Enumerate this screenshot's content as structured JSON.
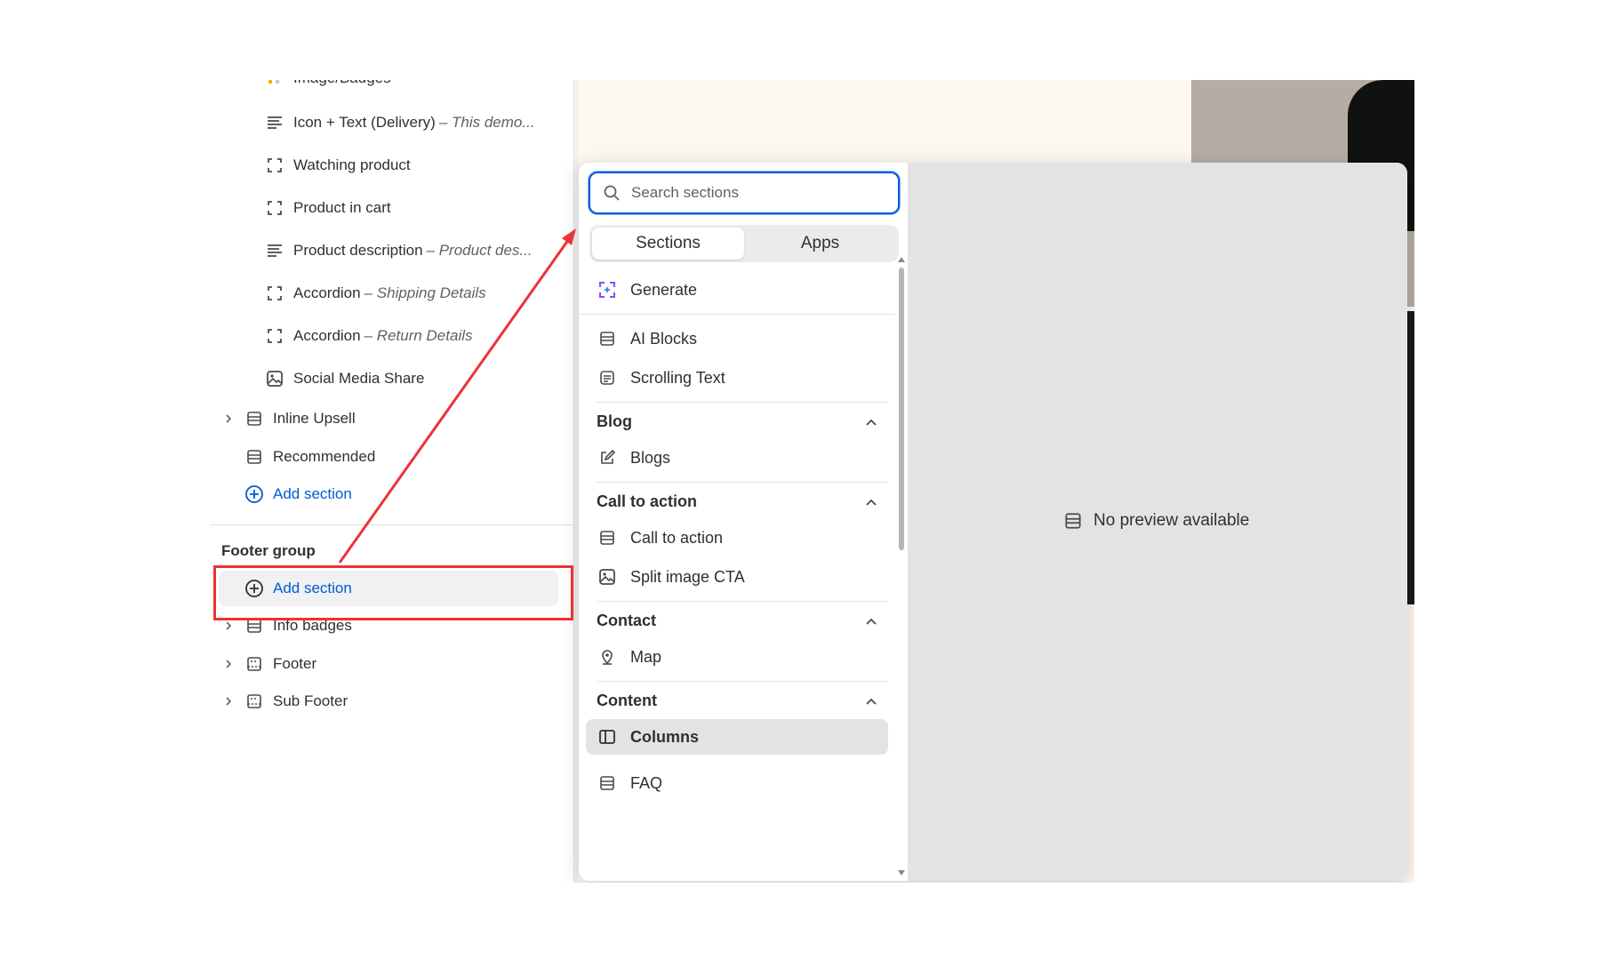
{
  "sidebar": {
    "top_partial_label": "Image/Badges",
    "blocks": [
      {
        "icon": "text-lines-icon",
        "label": "Icon + Text (Delivery)",
        "sub": "– This demo..."
      },
      {
        "icon": "block-frame-icon",
        "label": "Watching product",
        "sub": ""
      },
      {
        "icon": "block-frame-icon",
        "label": "Product in cart",
        "sub": ""
      },
      {
        "icon": "text-lines-icon",
        "label": "Product description",
        "sub": "– Product des..."
      },
      {
        "icon": "block-frame-icon",
        "label": "Accordion",
        "sub": "– Shipping Details"
      },
      {
        "icon": "block-frame-icon",
        "label": "Accordion",
        "sub": "– Return Details"
      },
      {
        "icon": "image-icon",
        "label": "Social Media Share",
        "sub": ""
      }
    ],
    "sections": [
      {
        "label": "Inline Upsell",
        "expandable": true
      },
      {
        "label": "Recommended",
        "expandable": false
      }
    ],
    "add_section_label": "Add section",
    "footer_group": {
      "heading": "Footer group",
      "add_section_label": "Add section",
      "items": [
        {
          "label": "Info badges"
        },
        {
          "label": "Footer"
        },
        {
          "label": "Sub Footer"
        }
      ]
    }
  },
  "picker": {
    "search": {
      "placeholder": "Search sections",
      "value": ""
    },
    "tabs": [
      {
        "label": "Sections",
        "active": true
      },
      {
        "label": "Apps",
        "active": false
      }
    ],
    "generate_label": "Generate",
    "top_items": [
      {
        "label": "AI Blocks",
        "icon": "section-rows-icon"
      },
      {
        "label": "Scrolling Text",
        "icon": "scrolling-text-icon"
      }
    ],
    "categories": [
      {
        "name": "Blog",
        "items": [
          {
            "label": "Blogs",
            "icon": "edit-icon"
          }
        ]
      },
      {
        "name": "Call to action",
        "items": [
          {
            "label": "Call to action",
            "icon": "section-rows-icon"
          },
          {
            "label": "Split image CTA",
            "icon": "image-icon"
          }
        ]
      },
      {
        "name": "Contact",
        "items": [
          {
            "label": "Map",
            "icon": "map-pin-icon"
          }
        ]
      },
      {
        "name": "Content",
        "items": [
          {
            "label": "Columns",
            "icon": "columns-icon",
            "selected": true
          },
          {
            "label": "FAQ",
            "icon": "section-rows-icon"
          }
        ]
      }
    ]
  },
  "preview": {
    "message": "No preview available"
  },
  "colors": {
    "accent": "#005bd3",
    "annotation": "#ee3235",
    "generate_icon": "#8a4fff"
  }
}
